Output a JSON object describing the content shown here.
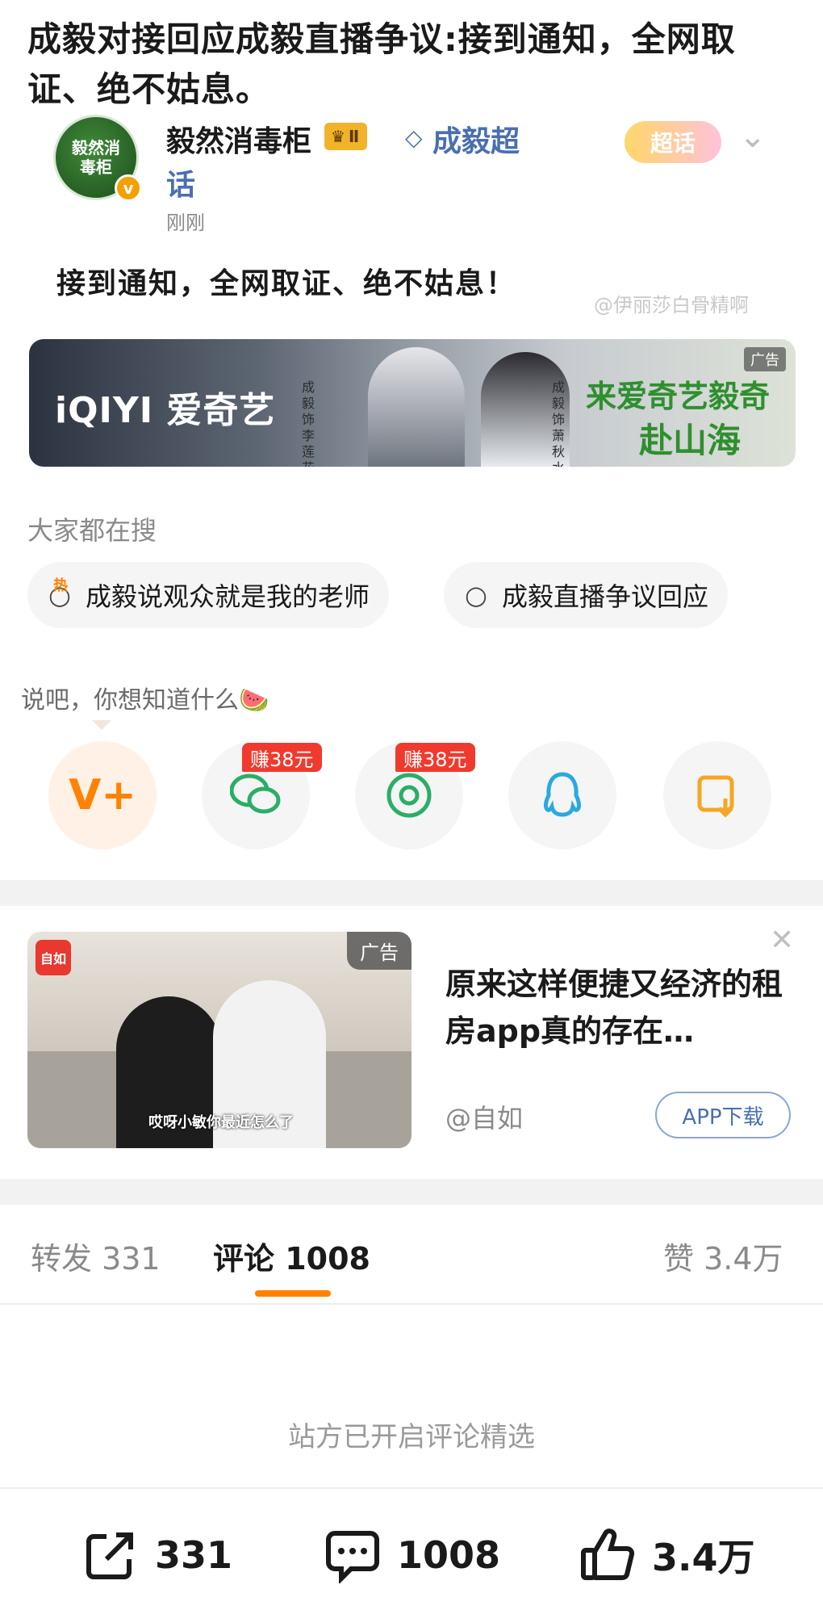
{
  "headline": "成毅对接回应成毅直播争议:接到通知，全网取证、绝不姑息。",
  "author": {
    "avatar_text": "毅然消毒柜",
    "name": "毅然消毒柜",
    "level_badge": "Ⅱ",
    "topic_link_line1": "成毅超",
    "topic_link_line2": "话",
    "time": "刚刚",
    "super_topic_badge": "超话"
  },
  "post": {
    "text": "接到通知，全网取证、绝不姑息！",
    "watermark": "@伊丽莎白骨精啊"
  },
  "banner": {
    "logo": "iQIYI 爱奇艺",
    "side_text_a": "成毅 饰 李莲花",
    "side_text_b": "成毅 饰 萧秋水",
    "slogan_line1": "来爱奇艺毅奇",
    "slogan_line2": "赴山海",
    "tag": "广告"
  },
  "search": {
    "section_label": "大家都在搜",
    "hot_mark": "热",
    "chips": [
      {
        "label": "成毅说观众就是我的老师"
      },
      {
        "label": "成毅直播争议回应"
      }
    ]
  },
  "share": {
    "prompt": "说吧，你想知道什么",
    "prompt_emoji": "🍉",
    "earn_badges": [
      "赚38元",
      "赚38元"
    ],
    "icons": [
      "weibo-v-plus-icon",
      "wechat-icon",
      "moments-icon",
      "qq-icon",
      "save-image-icon"
    ],
    "colors": {
      "orange": "#ff8200",
      "green": "#2aae67",
      "qq_blue": "#2aa9e0"
    }
  },
  "ad": {
    "tag": "广告",
    "logo": "自如",
    "caption": "哎呀小敏你最近怎么了",
    "title": "原来这样便捷又经济的租房app真的存在…",
    "brand": "@自如",
    "download_label": "APP下载"
  },
  "tabs": [
    {
      "label": "转发 331"
    },
    {
      "label": "评论 1008"
    },
    {
      "label": "赞 3.4万"
    }
  ],
  "comments": {
    "curated_notice": "站方已开启评论精选"
  },
  "actions": {
    "repost_count": "331",
    "comment_count": "1008",
    "like_count": "3.4万"
  },
  "accent_color": "#ff8200"
}
